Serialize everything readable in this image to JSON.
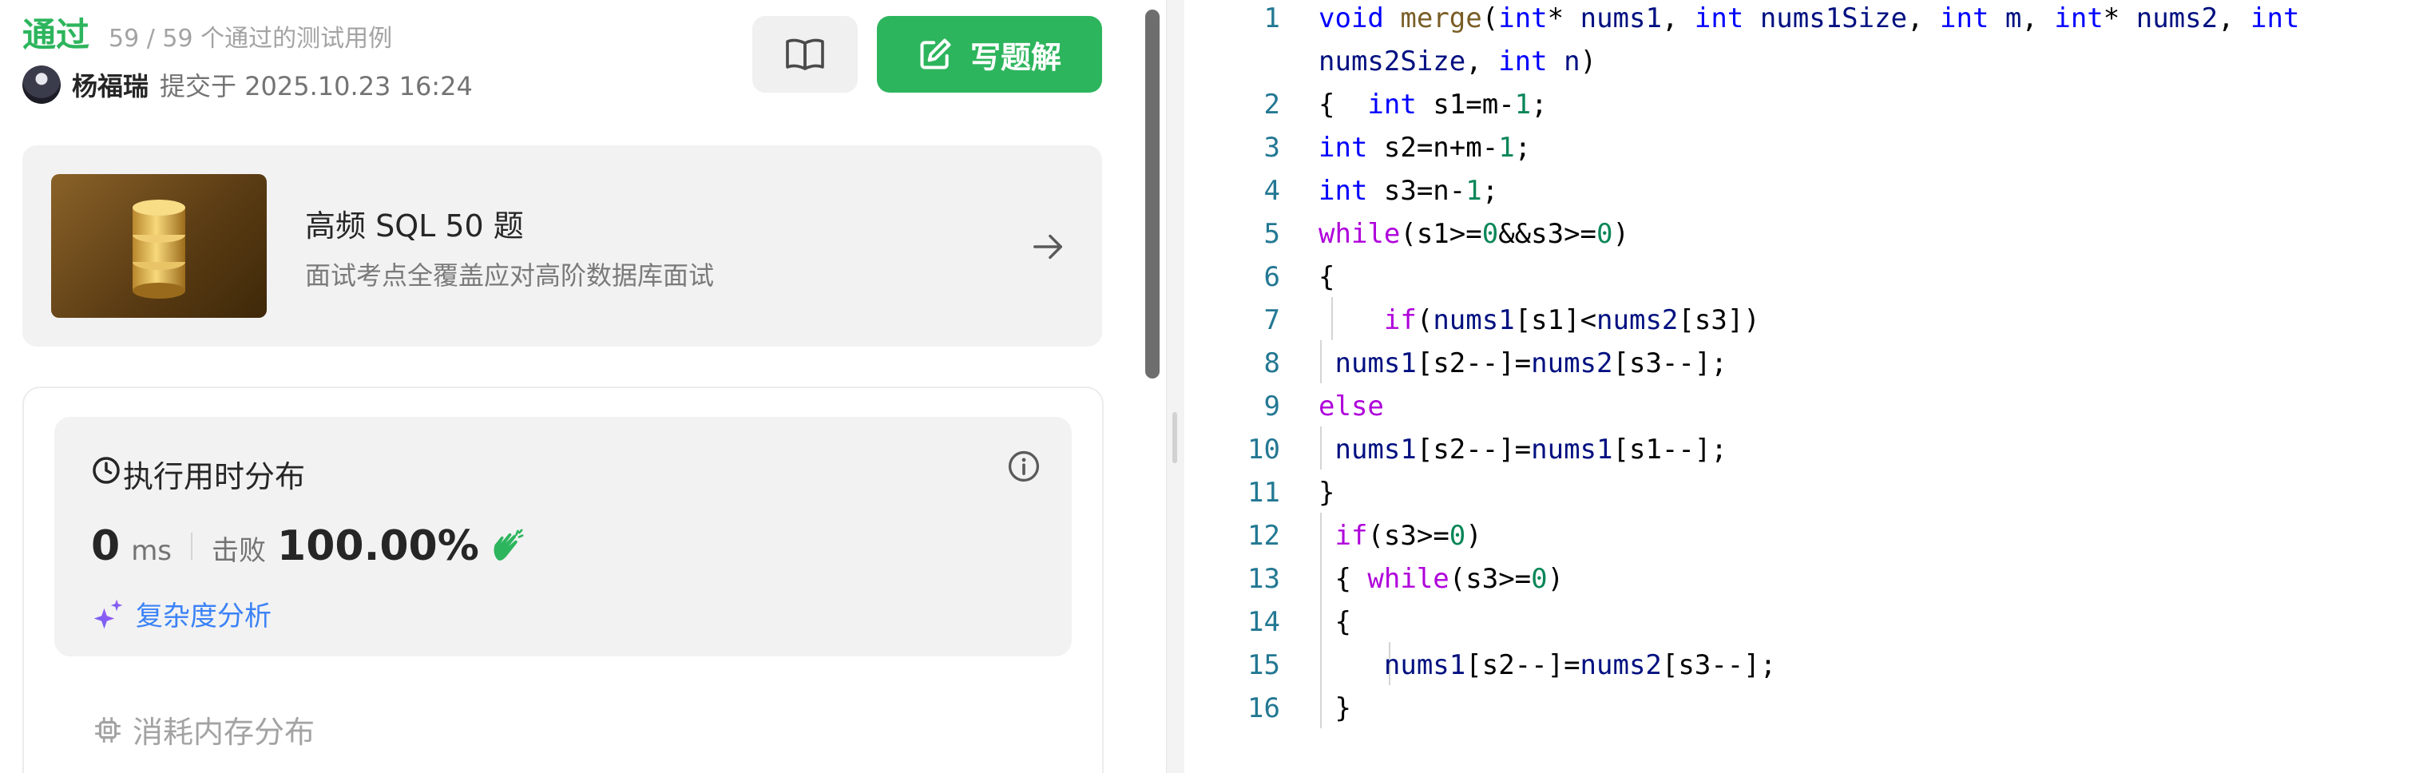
{
  "submission": {
    "status": "通过",
    "test_summary": "59 / 59 个通过的测试用例",
    "user_name": "杨福瑞",
    "submitted_at": "提交于 2025.10.23 16:24"
  },
  "buttons": {
    "solution_book_icon": "book-open-icon",
    "write_solution_label": "写题解",
    "write_solution_icon": "edit-icon"
  },
  "promo": {
    "title": "高频 SQL 50 题",
    "subtitle": "面试考点全覆盖应对高阶数据库面试"
  },
  "runtime": {
    "title": "执行用时分布",
    "value": "0",
    "unit": "ms",
    "beat_label": "击败",
    "beat_value": "100.00%",
    "complexity_label": "复杂度分析"
  },
  "memory": {
    "title": "消耗内存分布"
  },
  "colors": {
    "accent_green": "#2db55d",
    "link_blue": "#3b82f6",
    "keyword_blue": "#0000ff",
    "control_purple": "#af00db",
    "function_brown": "#795e26",
    "variable_navy": "#001080",
    "number_green": "#098658",
    "line_number": "#237893"
  },
  "code_lines": [
    {
      "n": "1",
      "tokens": [
        [
          "kw",
          "void"
        ],
        [
          "op",
          " "
        ],
        [
          "fn",
          "merge"
        ],
        [
          "op",
          "("
        ],
        [
          "kw",
          "int"
        ],
        [
          "op",
          "* "
        ],
        [
          "var",
          "nums1"
        ],
        [
          "op",
          ", "
        ],
        [
          "kw",
          "int"
        ],
        [
          "op",
          " "
        ],
        [
          "var",
          "nums1Size"
        ],
        [
          "op",
          ", "
        ],
        [
          "kw",
          "int"
        ],
        [
          "op",
          " "
        ],
        [
          "var",
          "m"
        ],
        [
          "op",
          ", "
        ],
        [
          "kw",
          "int"
        ],
        [
          "op",
          "* "
        ],
        [
          "var",
          "nums2"
        ],
        [
          "op",
          ", "
        ],
        [
          "kw",
          "int"
        ]
      ]
    },
    {
      "n": "",
      "tokens": [
        [
          "var",
          "nums2Size"
        ],
        [
          "op",
          ", "
        ],
        [
          "kw",
          "int"
        ],
        [
          "op",
          " "
        ],
        [
          "var",
          "n"
        ],
        [
          "op",
          ")"
        ]
      ]
    },
    {
      "n": "2",
      "tokens": [
        [
          "op",
          "{  "
        ],
        [
          "kw",
          "int"
        ],
        [
          "op",
          " s1=m-"
        ],
        [
          "num",
          "1"
        ],
        [
          "op",
          ";"
        ]
      ]
    },
    {
      "n": "3",
      "tokens": [
        [
          "kw",
          "int"
        ],
        [
          "op",
          " s2=n+m-"
        ],
        [
          "num",
          "1"
        ],
        [
          "op",
          ";"
        ]
      ]
    },
    {
      "n": "4",
      "tokens": [
        [
          "kw",
          "int"
        ],
        [
          "op",
          " s3=n-"
        ],
        [
          "num",
          "1"
        ],
        [
          "op",
          ";"
        ]
      ]
    },
    {
      "n": "5",
      "tokens": [
        [
          "ctl",
          "while"
        ],
        [
          "op",
          "(s1>="
        ],
        [
          "num",
          "0"
        ],
        [
          "op",
          "&&s3>="
        ],
        [
          "num",
          "0"
        ],
        [
          "op",
          ")"
        ]
      ]
    },
    {
      "n": "6",
      "tokens": [
        [
          "op",
          "{"
        ]
      ]
    },
    {
      "n": "7",
      "tokens": [
        [
          "op",
          "    "
        ],
        [
          "ctl",
          "if"
        ],
        [
          "op",
          "("
        ],
        [
          "var",
          "nums1"
        ],
        [
          "op",
          "[s1]<"
        ],
        [
          "var",
          "nums2"
        ],
        [
          "op",
          "[s3])"
        ]
      ]
    },
    {
      "n": "8",
      "tokens": [
        [
          "op",
          " "
        ],
        [
          "var",
          "nums1"
        ],
        [
          "op",
          "[s2--]="
        ],
        [
          "var",
          "nums2"
        ],
        [
          "op",
          "[s3--];"
        ]
      ]
    },
    {
      "n": "9",
      "tokens": [
        [
          "ctl",
          "else"
        ]
      ]
    },
    {
      "n": "10",
      "tokens": [
        [
          "op",
          " "
        ],
        [
          "var",
          "nums1"
        ],
        [
          "op",
          "[s2--]="
        ],
        [
          "var",
          "nums1"
        ],
        [
          "op",
          "[s1--];"
        ]
      ]
    },
    {
      "n": "11",
      "tokens": [
        [
          "op",
          "}"
        ]
      ]
    },
    {
      "n": "12",
      "tokens": [
        [
          "op",
          " "
        ],
        [
          "ctl",
          "if"
        ],
        [
          "op",
          "(s3>="
        ],
        [
          "num",
          "0"
        ],
        [
          "op",
          ")"
        ]
      ]
    },
    {
      "n": "13",
      "tokens": [
        [
          "op",
          " { "
        ],
        [
          "ctl",
          "while"
        ],
        [
          "op",
          "(s3>="
        ],
        [
          "num",
          "0"
        ],
        [
          "op",
          ")"
        ]
      ]
    },
    {
      "n": "14",
      "tokens": [
        [
          "op",
          " {"
        ]
      ]
    },
    {
      "n": "15",
      "tokens": [
        [
          "op",
          "    "
        ],
        [
          "var",
          "nums1"
        ],
        [
          "op",
          "[s2--]="
        ],
        [
          "var",
          "nums2"
        ],
        [
          "op",
          "[s3--];"
        ]
      ]
    },
    {
      "n": "16",
      "tokens": [
        [
          "op",
          " }"
        ]
      ]
    }
  ]
}
